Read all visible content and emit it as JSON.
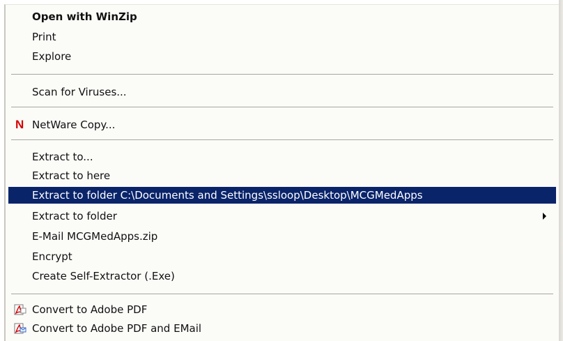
{
  "menu": {
    "open_with_winzip": "Open with WinZip",
    "print": "Print",
    "explore": "Explore",
    "scan_for_viruses": "Scan for Viruses...",
    "netware_copy": "NetWare Copy...",
    "extract_to": "Extract to...",
    "extract_to_here": "Extract to here",
    "extract_to_folder_path": "Extract to folder C:\\Documents and Settings\\ssloop\\Desktop\\MCGMedApps",
    "extract_to_folder": "Extract to folder",
    "email_zip": "E-Mail MCGMedApps.zip",
    "encrypt": "Encrypt",
    "create_self_extractor": "Create Self-Extractor (.Exe)",
    "convert_to_pdf": "Convert to Adobe PDF",
    "convert_to_pdf_email": "Convert to Adobe PDF and EMail"
  },
  "icons": {
    "netware": "netware-n-icon",
    "pdf": "adobe-pdf-icon",
    "pdf_email": "adobe-pdf-email-icon",
    "submenu": "submenu-arrow-icon"
  },
  "colors": {
    "selection": "#0a246a",
    "netware_red": "#d40000"
  }
}
